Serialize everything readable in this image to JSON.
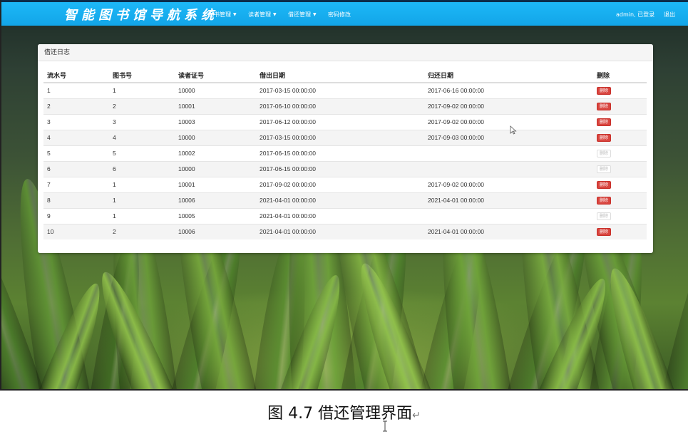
{
  "navbar": {
    "brand": "智能图书馆导航系统",
    "menu": [
      {
        "label": "图书管理",
        "dropdown": true
      },
      {
        "label": "读者管理",
        "dropdown": true
      },
      {
        "label": "借还管理",
        "dropdown": true
      },
      {
        "label": "密码修改",
        "dropdown": false
      }
    ],
    "user_status": "admin, 已登录",
    "logout": "退出"
  },
  "panel": {
    "title": "借还日志",
    "columns": [
      "流水号",
      "图书号",
      "读者证号",
      "借出日期",
      "归还日期",
      "删除"
    ],
    "delete_label": "删除",
    "rows": [
      {
        "id": "1",
        "book": "1",
        "reader": "10000",
        "lend": "2017-03-15 00:00:00",
        "back": "2017-06-16 00:00:00",
        "can_delete": true
      },
      {
        "id": "2",
        "book": "2",
        "reader": "10001",
        "lend": "2017-06-10 00:00:00",
        "back": "2017-09-02 00:00:00",
        "can_delete": true
      },
      {
        "id": "3",
        "book": "3",
        "reader": "10003",
        "lend": "2017-06-12 00:00:00",
        "back": "2017-09-02 00:00:00",
        "can_delete": true
      },
      {
        "id": "4",
        "book": "4",
        "reader": "10000",
        "lend": "2017-03-15 00:00:00",
        "back": "2017-09-03 00:00:00",
        "can_delete": true
      },
      {
        "id": "5",
        "book": "5",
        "reader": "10002",
        "lend": "2017-06-15 00:00:00",
        "back": "",
        "can_delete": false
      },
      {
        "id": "6",
        "book": "6",
        "reader": "10000",
        "lend": "2017-06-15 00:00:00",
        "back": "",
        "can_delete": false
      },
      {
        "id": "7",
        "book": "1",
        "reader": "10001",
        "lend": "2017-09-02 00:00:00",
        "back": "2017-09-02 00:00:00",
        "can_delete": true
      },
      {
        "id": "8",
        "book": "1",
        "reader": "10006",
        "lend": "2021-04-01 00:00:00",
        "back": "2021-04-01 00:00:00",
        "can_delete": true
      },
      {
        "id": "9",
        "book": "1",
        "reader": "10005",
        "lend": "2021-04-01 00:00:00",
        "back": "",
        "can_delete": false
      },
      {
        "id": "10",
        "book": "2",
        "reader": "10006",
        "lend": "2021-04-01 00:00:00",
        "back": "2021-04-01 00:00:00",
        "can_delete": true
      }
    ]
  },
  "caption": {
    "text": "图 4.7 借还管理界面",
    "return_mark": "↵"
  },
  "colors": {
    "navbar": "#12a5e8",
    "delete_button": "#d9453f"
  }
}
